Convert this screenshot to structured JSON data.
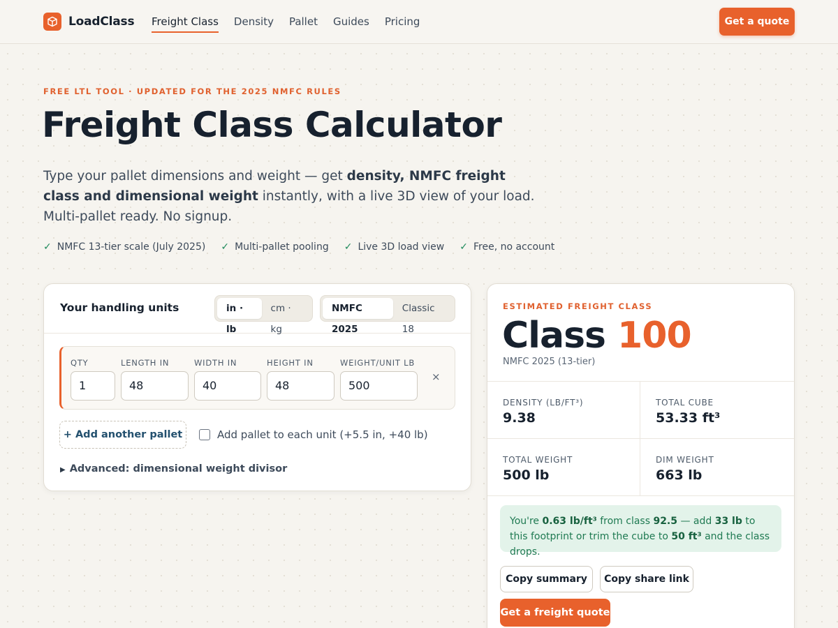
{
  "nav": {
    "brand": "LoadClass",
    "links": [
      "Freight Class",
      "Density",
      "Pallet",
      "Guides",
      "Pricing"
    ],
    "active_link": "Freight Class",
    "cta": "Get a quote",
    "accent": "#e8612c"
  },
  "hero": {
    "eyebrow": "FREE LTL TOOL · UPDATED FOR THE 2025 NMFC RULES",
    "title": "Freight Class Calculator",
    "subtitle_pre": "Type your pallet dimensions and weight — get ",
    "subtitle_bold": "density, NMFC freight class and dimensional weight",
    "subtitle_post": " instantly, with a live 3D view of your load. Multi-pallet ready. No signup.",
    "features": [
      "NMFC 13-tier scale (July 2025)",
      "Multi-pallet pooling",
      "Live 3D load view",
      "Free, no account"
    ],
    "feature_icon": "check-icon"
  },
  "units": {
    "title": "Your handling units",
    "unit_toggle": [
      "in · lb",
      "cm · kg"
    ],
    "unit_selected": "in · lb",
    "scale_toggle": [
      "NMFC 2025",
      "Classic 18"
    ],
    "scale_selected": "NMFC 2025",
    "labels": {
      "qty": "QTY",
      "length": "LENGTH IN",
      "width": "WIDTH IN",
      "height": "HEIGHT IN",
      "weight": "WEIGHT/UNIT LB"
    },
    "row": {
      "qty": "1",
      "length": "48",
      "width": "40",
      "height": "48",
      "weight": "500"
    },
    "remove": "×",
    "add_pallet": "+ Add another pallet",
    "pallet_option": "Add pallet to each unit (+5.5 in, +40 lb)",
    "pallet_option_checked": false,
    "advanced": "Advanced: dimensional weight divisor"
  },
  "result": {
    "eyebrow": "ESTIMATED FREIGHT CLASS",
    "class_word": "Class",
    "class_value": "100",
    "scale": "NMFC 2025 (13-tier)",
    "metrics": {
      "density": {
        "label": "DENSITY (LB/FT³)",
        "value": "9.38"
      },
      "cube": {
        "label": "TOTAL CUBE",
        "value": "53.33 ft³"
      },
      "weight": {
        "label": "TOTAL WEIGHT",
        "value": "500 lb"
      },
      "dim": {
        "label": "DIM WEIGHT",
        "value": "663 lb"
      }
    },
    "tip": {
      "t1": "You're ",
      "b1": "0.63 lb/ft³",
      "t2": " from class ",
      "b2": "92.5",
      "t3": " — add ",
      "b3": "33 lb",
      "t4": " to this footprint or trim the cube to ",
      "b4": "50 ft³",
      "t5": " and the class drops."
    },
    "copy_summary": "Copy summary",
    "copy_link": "Copy share link",
    "quote": "Get a freight quote"
  }
}
